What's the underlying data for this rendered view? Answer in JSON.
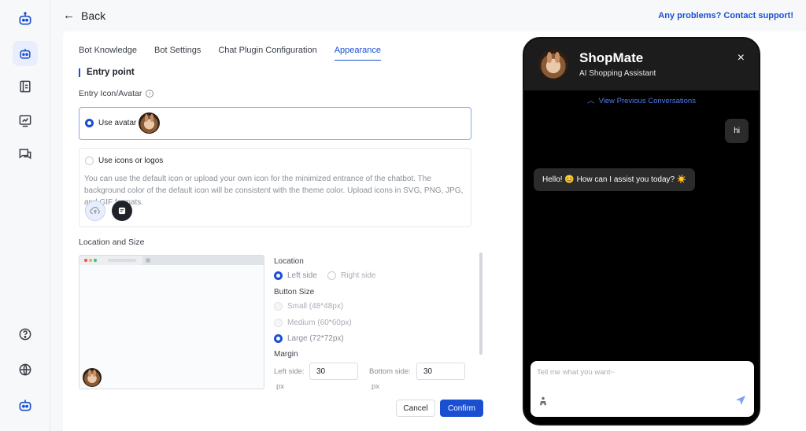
{
  "header": {
    "back_label": "Back",
    "support_link": "Any problems? Contact support!"
  },
  "tabs": [
    {
      "label": "Bot Knowledge",
      "active": false
    },
    {
      "label": "Bot Settings",
      "active": false
    },
    {
      "label": "Chat Plugin Configuration",
      "active": false
    },
    {
      "label": "Appearance",
      "active": true
    }
  ],
  "entry": {
    "section_title": "Entry point",
    "icon_label": "Entry Icon/Avatar",
    "info_glyph": "i",
    "use_avatar_label": "Use avatar",
    "use_icons_label": "Use icons or logos",
    "description": "You can use the default icon or upload your own icon for the minimized entrance of the chatbot. The background color of the default icon will be consistent with the theme color. Upload icons in SVG, PNG, JPG, and GIF formats.",
    "selected": "avatar"
  },
  "location_size": {
    "section_label": "Location and Size",
    "location_label": "Location",
    "left_side": "Left side",
    "right_side": "Right side",
    "location_selected": "left",
    "button_size_label": "Button Size",
    "small": "Small (48*48px)",
    "medium": "Medium (60*60px)",
    "large": "Large (72*72px)",
    "size_selected": "large",
    "margin_label": "Margin",
    "left_margin_label": "Left side:",
    "left_margin_value": "30",
    "bottom_margin_label": "Bottom side:",
    "bottom_margin_value": "30",
    "unit": "px"
  },
  "actions": {
    "cancel": "Cancel",
    "confirm": "Confirm"
  },
  "preview": {
    "bot_name": "ShopMate",
    "bot_subtitle": "AI Shopping Assistant",
    "close_glyph": "×",
    "view_previous": "View Previous Conversations",
    "user_message": "hi",
    "bot_message": "Hello! 😊 How can I assist you today? ☀️",
    "input_placeholder": "Tell me what you want~"
  },
  "colors": {
    "accent": "#1a4fd1",
    "phone_bg": "#000000",
    "bubble_bg": "#2b2b2b"
  }
}
